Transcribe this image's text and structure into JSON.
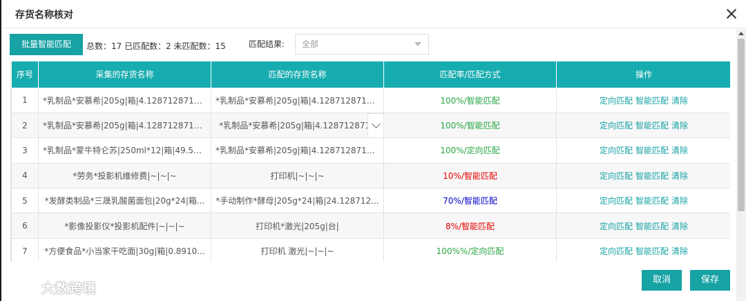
{
  "dialog": {
    "title": "存货名称核对"
  },
  "toolbar": {
    "batch_match_label": "批量智能匹配",
    "summary_text": "总数：17 已匹配数：2 未匹配数：15",
    "result_label": "匹配结果:",
    "result_selected": "全部"
  },
  "table": {
    "headers": [
      "序号",
      "采集的存货名称",
      "匹配的存货名称",
      "匹配率/匹配方式",
      "操作"
    ],
    "rows": [
      {
        "no": "1",
        "collected": "*乳制品*安慕希|205g|箱|4.1287128712...",
        "matched": "*乳制品*安慕希|205g|箱|4.1287128712...",
        "rate": "100%/智能匹配",
        "rate_color": "green"
      },
      {
        "no": "2",
        "collected": "*乳制品*安慕希|205g|箱|4.1287128712...",
        "matched": "*乳制品*安慕希|205g|箱|4.1287128712",
        "rate": "100%/智能匹配",
        "rate_color": "green"
      },
      {
        "no": "3",
        "collected": "*乳制品*蒙牛特仑苏|250ml*12|箱|49.50...",
        "matched": "*乳制品*安慕希|205g|箱|4.1287128712...",
        "rate": "100%/定向匹配",
        "rate_color": "green"
      },
      {
        "no": "4",
        "collected": "*劳务*投影机维修费|~|~|~",
        "matched": "打印机|~|~|~",
        "rate": "10%/智能匹配",
        "rate_color": "red"
      },
      {
        "no": "5",
        "collected": "*发酵类制品*三晟乳酸菌面包|20g*24|箱...",
        "matched": "*手动制作*酵母|205g*24|箱|24.128712...",
        "rate": "70%/智能匹配",
        "rate_color": "blue"
      },
      {
        "no": "6",
        "collected": "*影像投影仪*投影机配件|~|~|~",
        "matched": "打印机*激光|205g|台|",
        "rate": "8%/智能匹配",
        "rate_color": "red"
      },
      {
        "no": "7",
        "collected": "*方便食品*小当家干吃面|30g|箱|0.8910...",
        "matched": "打印机 激光|~|~|~",
        "rate": "100%%/定向匹配",
        "rate_color": "green"
      }
    ],
    "actions": {
      "directed": "定向匹配",
      "smart": "智能匹配",
      "clear": "清除"
    }
  },
  "footer": {
    "cancel_label": "取消",
    "save_label": "保存"
  },
  "watermark": {
    "text": "大数跨境"
  },
  "colors": {
    "accent": "#17a2a4",
    "header_bg": "#17acb0",
    "green": "#28a745",
    "red": "#e60000",
    "blue": "#0000cc"
  }
}
